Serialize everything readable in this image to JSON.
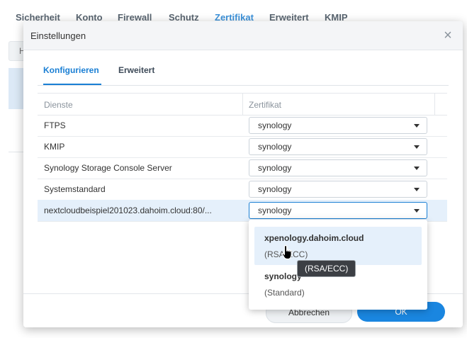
{
  "background": {
    "tabs": [
      "Sicherheit",
      "Konto",
      "Firewall",
      "Schutz",
      "Zertifikat",
      "Erweitert",
      "KMIP"
    ],
    "active_tab": "Zertifikat",
    "panel_letter": "H"
  },
  "dialog": {
    "title": "Einstellungen",
    "close_glyph": "×",
    "tabs": [
      "Konfigurieren",
      "Erweitert"
    ],
    "active_tab": "Konfigurieren",
    "grid": {
      "columns": [
        "Dienste",
        "Zertifikat"
      ],
      "rows": [
        {
          "service": "FTPS",
          "certificate": "synology"
        },
        {
          "service": "KMIP",
          "certificate": "synology"
        },
        {
          "service": "Synology Storage Console Server",
          "certificate": "synology"
        },
        {
          "service": "Systemstandard",
          "certificate": "synology"
        },
        {
          "service": "nextcloudbeispiel201023.dahoim.cloud:80/...",
          "certificate": "synology",
          "selected": true
        }
      ]
    },
    "footer": {
      "cancel_label": "Abbrechen",
      "ok_label": "OK"
    }
  },
  "dropdown": {
    "options": [
      {
        "name": "xpenology.dahoim.cloud",
        "sub": "(RSA/ECC)",
        "hovered": true
      },
      {
        "name": "synology",
        "sub": "(Standard)",
        "hovered": false
      }
    ]
  },
  "tooltip": {
    "text": "(RSA/ECC)"
  },
  "colors": {
    "accent": "#1a7fd4",
    "ok_button": "#1a86e0",
    "selected_row": "#e5f0fb",
    "tooltip_bg": "#3c3f44"
  },
  "icons": {
    "close": "close-icon",
    "caret": "chevron-down-icon",
    "cursor": "hand-pointer-icon"
  }
}
